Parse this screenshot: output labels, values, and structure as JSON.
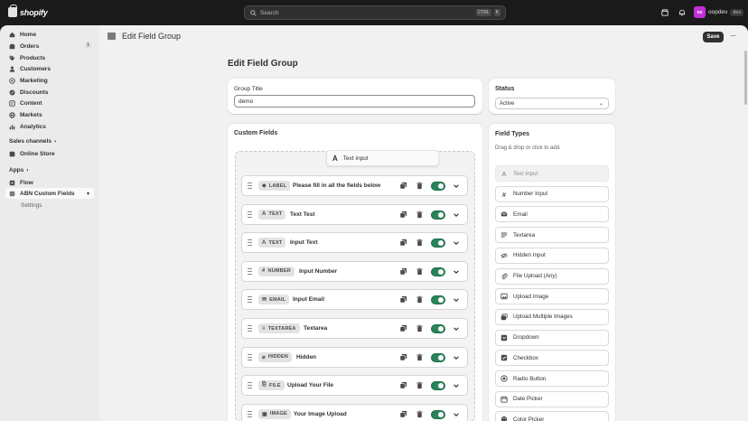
{
  "topbar": {
    "brand": "shopify",
    "search_placeholder": "Search",
    "shortcut": [
      "CTRL",
      "K"
    ],
    "user_initials": "oo",
    "user_name": "oopdev",
    "user_badge": "dev"
  },
  "sidebar": {
    "items": [
      {
        "label": "Home",
        "icon": "home-icon"
      },
      {
        "label": "Orders",
        "icon": "orders-icon",
        "count": "1"
      },
      {
        "label": "Products",
        "icon": "tag-icon"
      },
      {
        "label": "Customers",
        "icon": "person-icon"
      },
      {
        "label": "Marketing",
        "icon": "target-icon"
      },
      {
        "label": "Discounts",
        "icon": "discount-icon"
      },
      {
        "label": "Content",
        "icon": "content-icon"
      },
      {
        "label": "Markets",
        "icon": "globe-icon"
      },
      {
        "label": "Analytics",
        "icon": "chart-icon"
      }
    ],
    "sales_channels_label": "Sales channels",
    "online_store": "Online Store",
    "apps_label": "Apps",
    "flow": "Flow",
    "app_name": "ABN Custom Fields",
    "settings": "Settings"
  },
  "appbar": {
    "title": "Edit Field Group",
    "save_label": "Save",
    "more": "···"
  },
  "page": {
    "title": "Edit Field Group",
    "group_title_label": "Group Title",
    "group_title_value": "demo",
    "status_label": "Status",
    "status_value": "Active",
    "custom_fields_title": "Custom Fields",
    "drag_ghost": "Text input",
    "field_types_title": "Field Types",
    "field_types_hint": "Drag & drop or click to add."
  },
  "fields": [
    {
      "type": "LABEL",
      "glyph": "◆",
      "label": "Please fill in all the fields below",
      "enabled": true
    },
    {
      "type": "TEXT",
      "glyph": "A",
      "label": "Text Test",
      "enabled": true
    },
    {
      "type": "TEXT",
      "glyph": "A",
      "label": "Input Text",
      "enabled": true
    },
    {
      "type": "NUMBER",
      "glyph": "#",
      "label": "Input Number",
      "enabled": true
    },
    {
      "type": "EMAIL",
      "glyph": "✉",
      "label": "Input Email",
      "enabled": true
    },
    {
      "type": "TEXTAREA",
      "glyph": "≡",
      "label": "Textarea",
      "enabled": true
    },
    {
      "type": "HIDDEN",
      "glyph": "⌀",
      "label": "Hidden",
      "enabled": true
    },
    {
      "type": "FILE",
      "glyph": "⎘",
      "label": "Upload Your File",
      "enabled": true
    },
    {
      "type": "IMAGE",
      "glyph": "▣",
      "label": "Your Image Upload",
      "enabled": true
    }
  ],
  "field_types": [
    {
      "label": "Text Input",
      "icon": "text-icon",
      "disabled": true
    },
    {
      "label": "Number Input",
      "icon": "hash-icon"
    },
    {
      "label": "Email",
      "icon": "email-icon"
    },
    {
      "label": "Textarea",
      "icon": "textarea-icon"
    },
    {
      "label": "Hidden Input",
      "icon": "hidden-icon"
    },
    {
      "label": "File Upload (Any)",
      "icon": "paperclip-icon"
    },
    {
      "label": "Upload Image",
      "icon": "image-icon"
    },
    {
      "label": "Upload Multiple Images",
      "icon": "images-icon"
    },
    {
      "label": "Dropdown",
      "icon": "dropdown-icon"
    },
    {
      "label": "Checkbox",
      "icon": "checkbox-icon"
    },
    {
      "label": "Radio Button",
      "icon": "radio-icon"
    },
    {
      "label": "Date Picker",
      "icon": "calendar-icon"
    },
    {
      "label": "Color Picker",
      "icon": "palette-icon"
    }
  ],
  "colors": {
    "toggle_on": "#29845a",
    "brand_dark": "#1a1a1a",
    "avatar": "#c32fd8"
  }
}
